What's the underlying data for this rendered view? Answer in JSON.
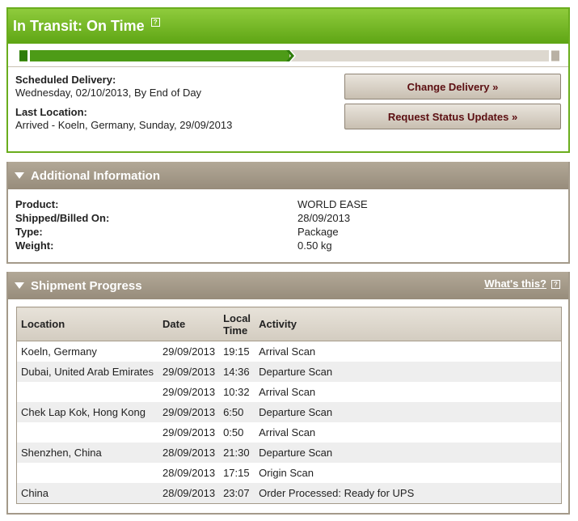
{
  "status": {
    "title": "In Transit: On Time",
    "help_icon": "question-icon",
    "progress_fraction": 0.5
  },
  "delivery": {
    "scheduled_label": "Scheduled Delivery:",
    "scheduled_value": "Wednesday, 02/10/2013, By End of Day",
    "last_location_label": "Last Location:",
    "last_location_value": "Arrived - Koeln, Germany, Sunday, 29/09/2013"
  },
  "actions": {
    "change_delivery": "Change Delivery »",
    "request_updates": "Request Status Updates »"
  },
  "additional_info": {
    "title": "Additional Information",
    "rows": [
      {
        "label": "Product:",
        "value": "WORLD EASE"
      },
      {
        "label": "Shipped/Billed On:",
        "value": "28/09/2013"
      },
      {
        "label": "Type:",
        "value": "Package"
      },
      {
        "label": "Weight:",
        "value": "0.50 kg"
      }
    ]
  },
  "shipment_progress": {
    "title": "Shipment Progress",
    "whats_this": "What's this?",
    "columns": {
      "location": "Location",
      "date": "Date",
      "time_line1": "Local",
      "time_line2": "Time",
      "activity": "Activity"
    },
    "rows": [
      {
        "location": "Koeln, Germany",
        "date": "29/09/2013",
        "time": "19:15",
        "activity": "Arrival Scan"
      },
      {
        "location": "Dubai, United Arab Emirates",
        "date": "29/09/2013",
        "time": "14:36",
        "activity": "Departure Scan"
      },
      {
        "location": "",
        "date": "29/09/2013",
        "time": "10:32",
        "activity": "Arrival Scan"
      },
      {
        "location": "Chek Lap Kok, Hong Kong",
        "date": "29/09/2013",
        "time": "6:50",
        "activity": "Departure Scan"
      },
      {
        "location": "",
        "date": "29/09/2013",
        "time": "0:50",
        "activity": "Arrival Scan"
      },
      {
        "location": "Shenzhen, China",
        "date": "28/09/2013",
        "time": "21:30",
        "activity": "Departure Scan"
      },
      {
        "location": "",
        "date": "28/09/2013",
        "time": "17:15",
        "activity": "Origin Scan"
      },
      {
        "location": "China",
        "date": "28/09/2013",
        "time": "23:07",
        "activity": "Order Processed: Ready for UPS"
      }
    ]
  },
  "colors": {
    "brand_green": "#6aad1d",
    "progress_green": "#4d9b17",
    "section_header": "#a49a8a",
    "button_text": "#5c0f12"
  }
}
